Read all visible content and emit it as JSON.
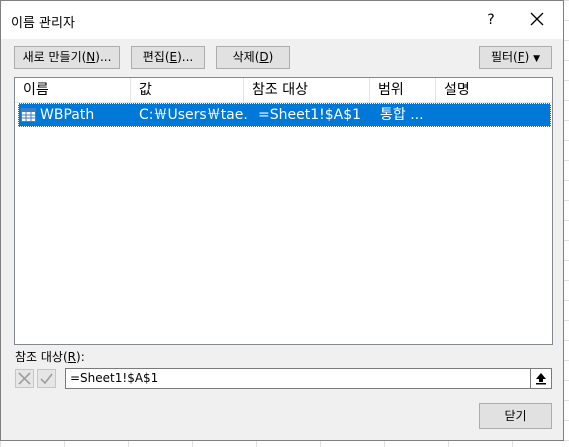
{
  "window": {
    "title": "이름 관리자",
    "help_label": "?"
  },
  "toolbar": {
    "new_prefix": "새로 만들기(",
    "new_key": "N",
    "new_suffix": ")...",
    "edit_prefix": "편집(",
    "edit_key": "E",
    "edit_suffix": ")...",
    "delete_prefix": "삭제(",
    "delete_key": "D",
    "delete_suffix": ")",
    "filter_prefix": "필터(",
    "filter_key": "F",
    "filter_suffix": ")"
  },
  "table": {
    "columns": [
      "이름",
      "값",
      "참조 대상",
      "범위",
      "설명"
    ],
    "rows": [
      {
        "name": "WBPath",
        "value": "C:￦Users￦tae...",
        "refers_to": "=Sheet1!$A$1",
        "scope": "통합 ...",
        "comment": ""
      }
    ]
  },
  "refers": {
    "label_prefix": "참조 대상(",
    "label_key": "R",
    "label_suffix": "):",
    "value": "=Sheet1!$A$1"
  },
  "footer": {
    "close_label": "닫기"
  },
  "colors": {
    "selection": "#0078d7",
    "dialog_bg": "#f0f0f0",
    "button_bg": "#e1e1e1"
  }
}
